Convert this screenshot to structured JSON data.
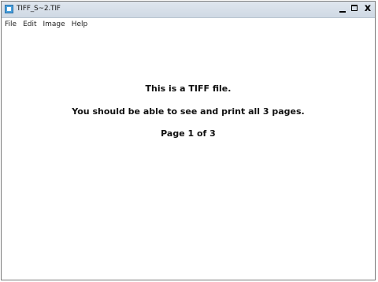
{
  "window": {
    "title": "TIFF_S~2.TIF",
    "controls": {
      "minimize": "minimize",
      "maximize": "maximize",
      "close": "x"
    }
  },
  "menu": {
    "items": [
      "File",
      "Edit",
      "Image",
      "Help"
    ]
  },
  "document": {
    "lines": [
      "This is a TIFF file.",
      "You should be able to see and print all 3 pages.",
      "Page 1 of 3"
    ]
  },
  "icons": {
    "app": "image-viewer-icon"
  }
}
